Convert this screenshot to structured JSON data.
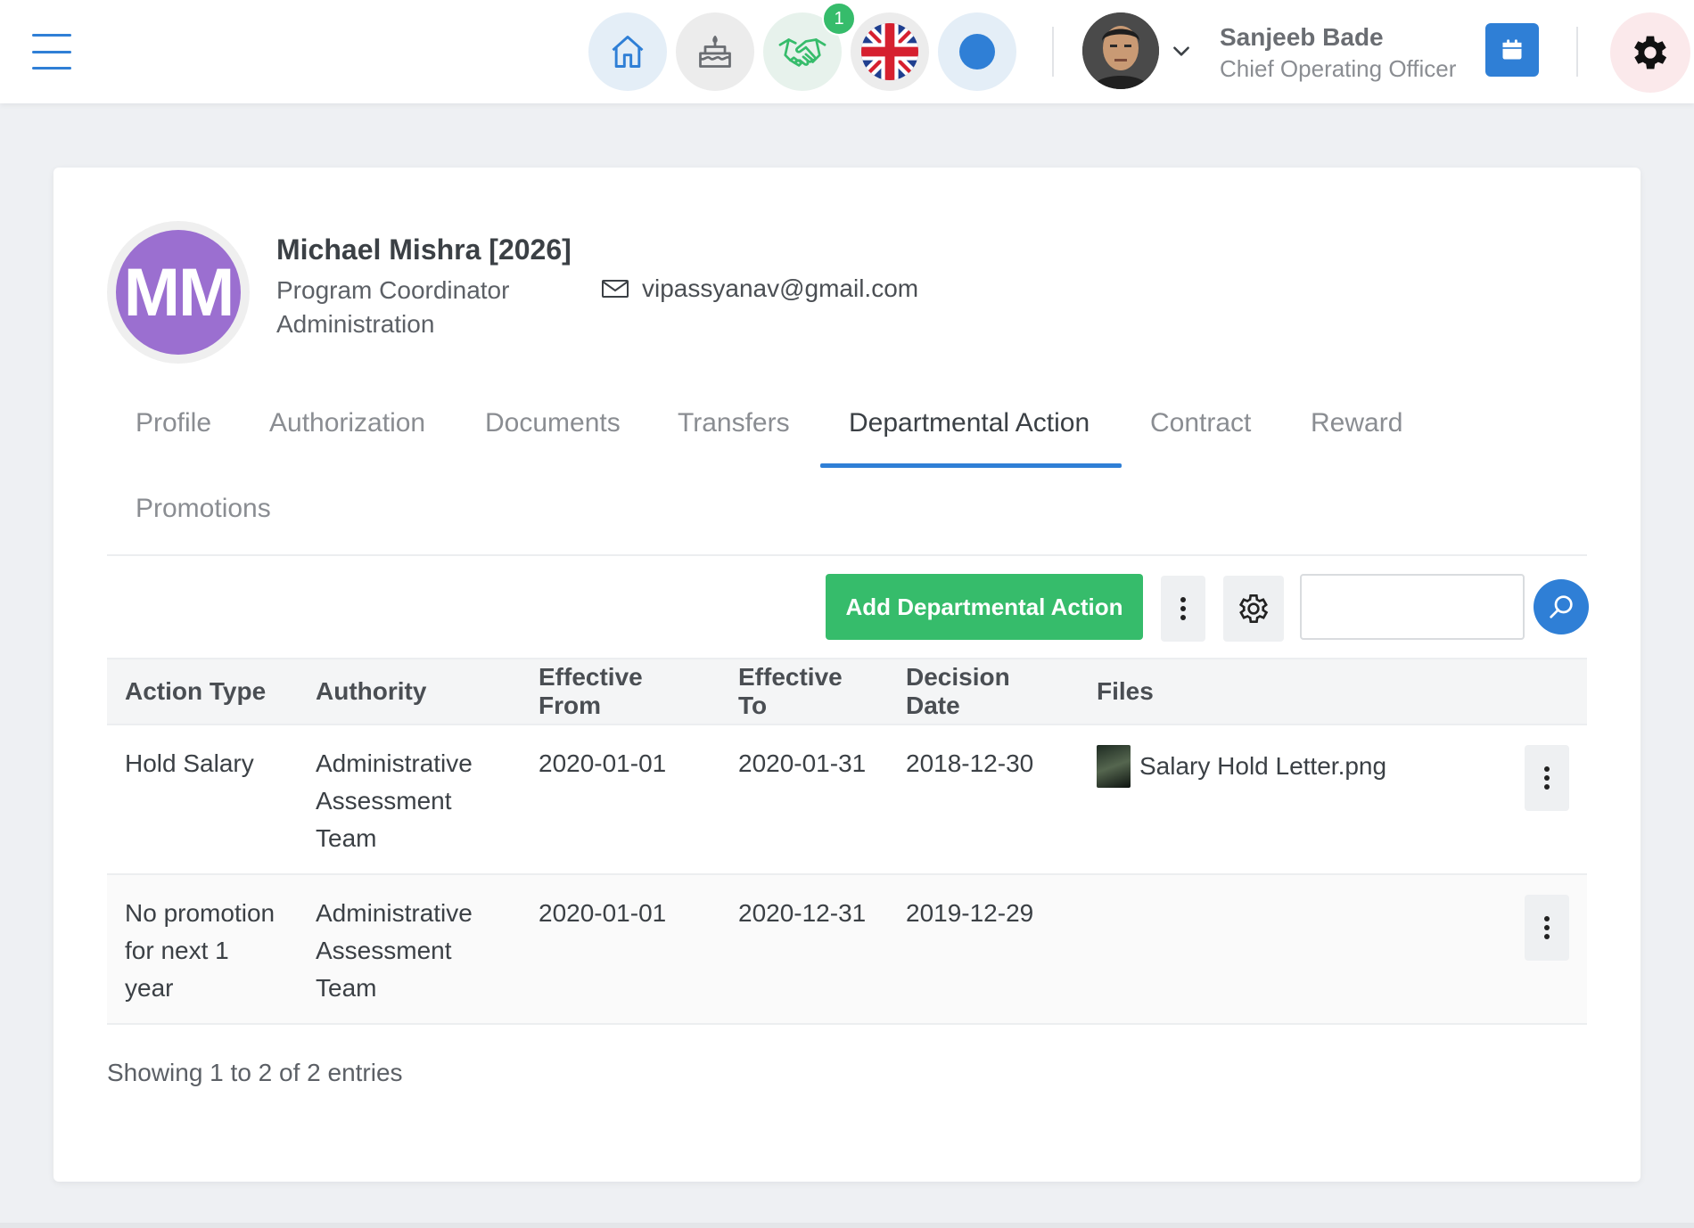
{
  "topbar": {
    "notification_count": "1",
    "user": {
      "name": "Sanjeeb Bade",
      "role": "Chief Operating Officer"
    },
    "icons": [
      "menu-icon",
      "home-icon",
      "cake-icon",
      "handshake-icon",
      "uk-flag-icon",
      "status-dot-icon",
      "chevron-down-icon",
      "calendar-icon",
      "gear-icon"
    ],
    "colors": {
      "accent": "#2f7fd6",
      "success": "#36bc6b"
    }
  },
  "employee": {
    "initials": "MM",
    "name": "Michael Mishra [2026]",
    "title": "Program Coordinator",
    "department": "Administration",
    "email": "vipassyanav@gmail.com",
    "avatar_color": "#9b6fd0"
  },
  "tabs": [
    {
      "label": "Profile"
    },
    {
      "label": "Authorization"
    },
    {
      "label": "Documents"
    },
    {
      "label": "Transfers"
    },
    {
      "label": "Departmental Action"
    },
    {
      "label": "Contract"
    },
    {
      "label": "Reward"
    },
    {
      "label": "Promotions"
    }
  ],
  "active_tab": "Departmental Action",
  "toolbar": {
    "add_label": "Add Departmental Action",
    "search_placeholder": ""
  },
  "table": {
    "headers": [
      "Action Type",
      "Authority",
      "Effective From",
      "Effective To",
      "Decision Date",
      "Files"
    ],
    "rows": [
      {
        "action_type": "Hold Salary",
        "authority": "Administrative Assessment Team",
        "effective_from": "2020-01-01",
        "effective_to": "2020-01-31",
        "decision_date": "2018-12-30",
        "file": "Salary Hold Letter.png"
      },
      {
        "action_type": "No promotion for next 1 year",
        "authority": "Administrative Assessment Team",
        "effective_from": "2020-01-01",
        "effective_to": "2020-12-31",
        "decision_date": "2019-12-29",
        "file": ""
      }
    ]
  },
  "footer": {
    "info": "Showing 1 to 2 of 2 entries"
  }
}
